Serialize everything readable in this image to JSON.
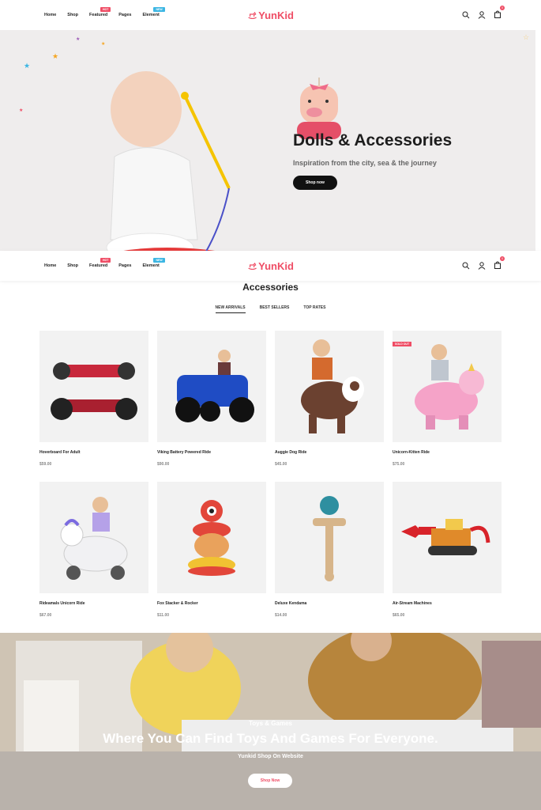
{
  "nav": {
    "items": [
      {
        "label": "Home"
      },
      {
        "label": "Shop"
      },
      {
        "label": "Featured",
        "tag": "HOT",
        "tag_color": "#ef4d65"
      },
      {
        "label": "Pages"
      },
      {
        "label": "Element",
        "tag": "NEW",
        "tag_color": "#3cb6e3"
      }
    ],
    "logo": "YunKid",
    "cart_count": "0",
    "icons": [
      "search-icon",
      "user-icon",
      "bag-icon"
    ]
  },
  "hero": {
    "title": "Dolls & Accessories",
    "subtitle": "Inspiration from the city, sea & the journey",
    "button": "Shop now"
  },
  "section": {
    "title": "Accessories",
    "tabs": [
      "NEW ARRIVALS",
      "BEST SELLERS",
      "TOP RATES"
    ],
    "active_tab": "NEW ARRIVALS"
  },
  "products": [
    {
      "name": "Hoverboard For Adult",
      "price": "$59.00",
      "badge": ""
    },
    {
      "name": "Viking Battery Powered Ride",
      "price": "$90.00",
      "badge": ""
    },
    {
      "name": "Auggie Dog Ride",
      "price": "$45.00",
      "badge": ""
    },
    {
      "name": "Unicorn-Kitten Ride",
      "price": "$75.00",
      "badge": "SOLD OUT"
    },
    {
      "name": "Rideamals Unicorn Ride",
      "price": "$67.00",
      "badge": ""
    },
    {
      "name": "Fox Stacker & Rocker",
      "price": "$11.00",
      "badge": ""
    },
    {
      "name": "Deluxe Kendama",
      "price": "$14.00",
      "badge": ""
    },
    {
      "name": "Air-Stream Machines",
      "price": "$65.00",
      "badge": ""
    }
  ],
  "banner": {
    "kicker": "Toys & Games",
    "title": "Where You Can Find Toys And Games For Everyone.",
    "subtitle": "Yunkid Shop On Website",
    "button": "Shop Now"
  },
  "colors": {
    "accent": "#ef4d65",
    "dark": "#111111",
    "hero_bg": "#efeded",
    "card_bg": "#f2f2f2"
  }
}
